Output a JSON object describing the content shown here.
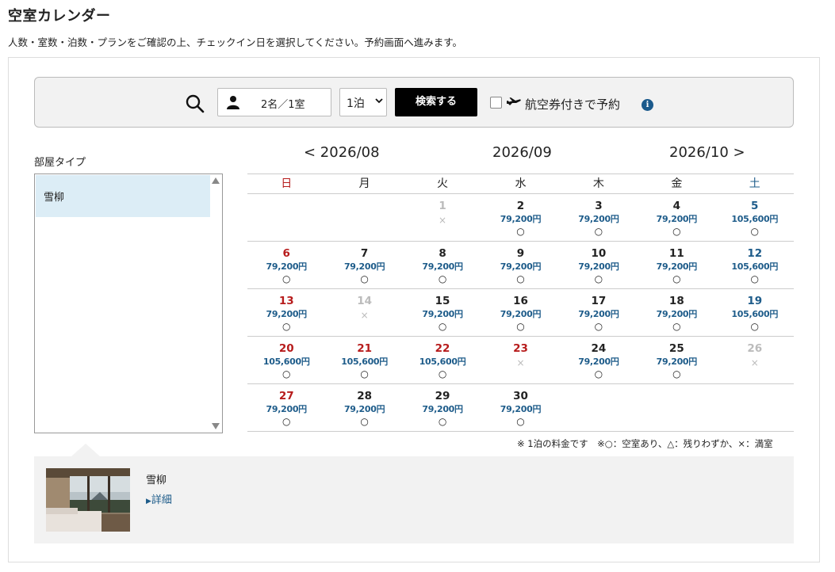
{
  "page": {
    "title": "空室カレンダー",
    "subtitle": "人数・室数・泊数・プランをご確認の上、チェックイン日を選択してください。予約画面へ進みます。"
  },
  "search": {
    "guests": "2名／1室",
    "nights": "1泊",
    "button_label": "検索する",
    "flight_label": "航空券付きで予約",
    "info_icon_text": "i"
  },
  "room_types": {
    "label": "部屋タイプ",
    "items": [
      "雪柳"
    ]
  },
  "months": {
    "prev": "< 2026/08",
    "current": "2026/09",
    "next": "2026/10 >"
  },
  "weekdays": [
    "日",
    "月",
    "火",
    "水",
    "木",
    "金",
    "土"
  ],
  "calendar": [
    [
      {
        "day": "",
        "price": "",
        "mark": "",
        "type": "empty"
      },
      {
        "day": "",
        "price": "",
        "mark": "",
        "type": "empty"
      },
      {
        "day": "1",
        "price": "",
        "mark": "×",
        "type": "full"
      },
      {
        "day": "2",
        "price": "79,200円",
        "mark": "○",
        "type": "normal"
      },
      {
        "day": "3",
        "price": "79,200円",
        "mark": "○",
        "type": "normal"
      },
      {
        "day": "4",
        "price": "79,200円",
        "mark": "○",
        "type": "normal"
      },
      {
        "day": "5",
        "price": "105,600円",
        "mark": "○",
        "type": "sat"
      }
    ],
    [
      {
        "day": "6",
        "price": "79,200円",
        "mark": "○",
        "type": "sun"
      },
      {
        "day": "7",
        "price": "79,200円",
        "mark": "○",
        "type": "normal"
      },
      {
        "day": "8",
        "price": "79,200円",
        "mark": "○",
        "type": "normal"
      },
      {
        "day": "9",
        "price": "79,200円",
        "mark": "○",
        "type": "normal"
      },
      {
        "day": "10",
        "price": "79,200円",
        "mark": "○",
        "type": "normal"
      },
      {
        "day": "11",
        "price": "79,200円",
        "mark": "○",
        "type": "normal"
      },
      {
        "day": "12",
        "price": "105,600円",
        "mark": "○",
        "type": "sat"
      }
    ],
    [
      {
        "day": "13",
        "price": "79,200円",
        "mark": "○",
        "type": "sun"
      },
      {
        "day": "14",
        "price": "",
        "mark": "×",
        "type": "full"
      },
      {
        "day": "15",
        "price": "79,200円",
        "mark": "○",
        "type": "normal"
      },
      {
        "day": "16",
        "price": "79,200円",
        "mark": "○",
        "type": "normal"
      },
      {
        "day": "17",
        "price": "79,200円",
        "mark": "○",
        "type": "normal"
      },
      {
        "day": "18",
        "price": "79,200円",
        "mark": "○",
        "type": "normal"
      },
      {
        "day": "19",
        "price": "105,600円",
        "mark": "○",
        "type": "sat"
      }
    ],
    [
      {
        "day": "20",
        "price": "105,600円",
        "mark": "○",
        "type": "sun"
      },
      {
        "day": "21",
        "price": "105,600円",
        "mark": "○",
        "type": "sun"
      },
      {
        "day": "22",
        "price": "105,600円",
        "mark": "○",
        "type": "sun"
      },
      {
        "day": "23",
        "price": "",
        "mark": "×",
        "type": "holidayfull"
      },
      {
        "day": "24",
        "price": "79,200円",
        "mark": "○",
        "type": "normal"
      },
      {
        "day": "25",
        "price": "79,200円",
        "mark": "○",
        "type": "normal"
      },
      {
        "day": "26",
        "price": "",
        "mark": "×",
        "type": "full"
      }
    ],
    [
      {
        "day": "27",
        "price": "79,200円",
        "mark": "○",
        "type": "sun"
      },
      {
        "day": "28",
        "price": "79,200円",
        "mark": "○",
        "type": "normal"
      },
      {
        "day": "29",
        "price": "79,200円",
        "mark": "○",
        "type": "normal"
      },
      {
        "day": "30",
        "price": "79,200円",
        "mark": "○",
        "type": "normal"
      },
      {
        "day": "",
        "price": "",
        "mark": "",
        "type": "empty"
      },
      {
        "day": "",
        "price": "",
        "mark": "",
        "type": "empty"
      },
      {
        "day": "",
        "price": "",
        "mark": "",
        "type": "empty"
      }
    ]
  ],
  "note": "※ 1泊の料金です　※○：空室あり、△：残りわずか、×：満室",
  "detail": {
    "room_name": "雪柳",
    "link_label": "詳細"
  },
  "colors": {
    "sunday": "#b71c1c",
    "saturday": "#1e5c8a",
    "price": "#1e5c8a",
    "selected_room_bg": "#dcedf6"
  }
}
